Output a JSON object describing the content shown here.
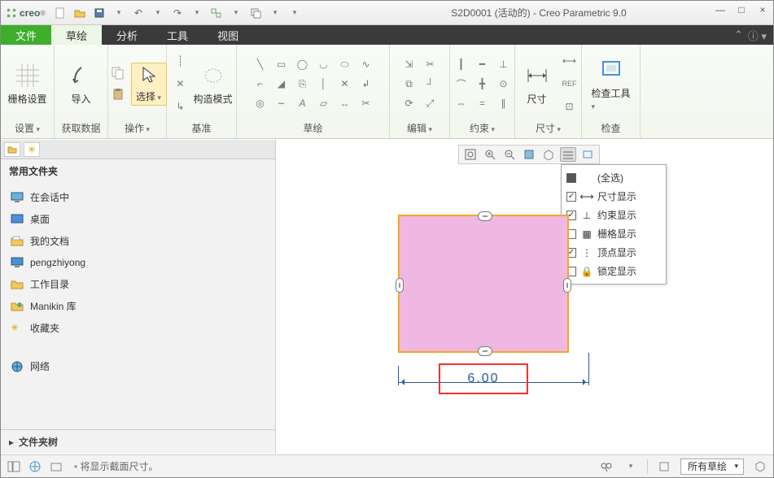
{
  "app": {
    "brand": "creo",
    "title": "S2D0001 (活动的) - Creo Parametric 9.0"
  },
  "tabs": {
    "file": "文件",
    "sketch": "草绘",
    "analysis": "分析",
    "tools": "工具",
    "view": "视图"
  },
  "ribbon": {
    "grid_setup": "栅格设置",
    "setup_label": "设置",
    "import": "导入",
    "get_data_label": "获取数据",
    "select": "选择",
    "operate_label": "操作",
    "construct_mode": "构造模式",
    "datum_label": "基准",
    "sketch_label": "草绘",
    "edit_label": "编辑",
    "constraint_label": "约束",
    "dimension": "尺寸",
    "dimension_label": "尺寸",
    "inspect_tools": "检查工具",
    "inspect_label": "检查"
  },
  "sidebar": {
    "header": "常用文件夹",
    "in_session": "在会话中",
    "desktop": "桌面",
    "my_docs": "我的文档",
    "user_dir": "pengzhiyong",
    "work_dir": "工作目录",
    "manikin": "Manikin 库",
    "favorites": "收藏夹",
    "network": "网络",
    "folder_tree": "文件夹树"
  },
  "popup": {
    "select_all": "(全选)",
    "dim_display": "尺寸显示",
    "constraint_display": "约束显示",
    "grid_display": "栅格显示",
    "vertex_display": "顶点显示",
    "lock_display": "锁定显示"
  },
  "dimension_value": "6.00",
  "status": {
    "message": "将显示截面尺寸。",
    "filter": "所有草绘"
  }
}
